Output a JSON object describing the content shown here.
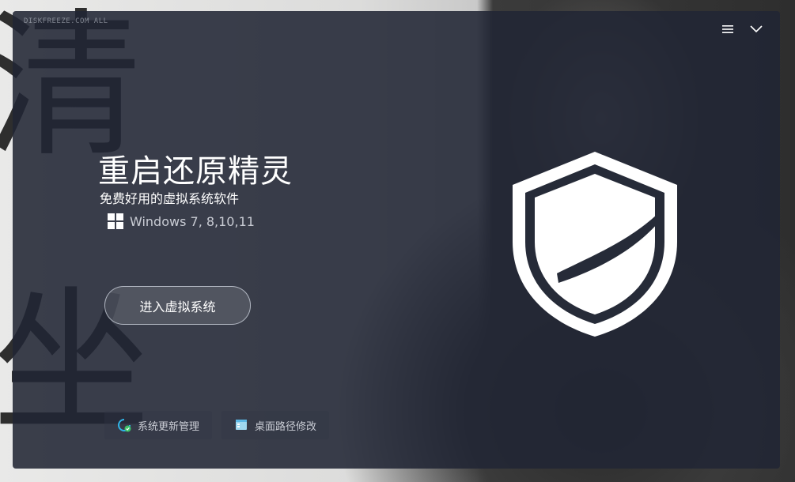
{
  "window": {
    "watermark": "DISKFREEZE.COM ALL"
  },
  "top_controls": {
    "menu_icon": "hamburger-menu-icon",
    "collapse_icon": "chevron-down-icon"
  },
  "hero": {
    "title": "重启还原精灵",
    "subtitle": "免费好用的虚拟系统软件",
    "os_label": "Windows  7, 8,10,11",
    "os_icon": "windows-logo-icon"
  },
  "actions": {
    "enter_label": "进入虚拟系统"
  },
  "tools": [
    {
      "label": "系统更新管理",
      "icon": "refresh-check-icon"
    },
    {
      "label": "桌面路径修改",
      "icon": "desktop-folder-icon"
    }
  ],
  "background": {
    "glyph_top": "清",
    "glyph_bottom": "坐"
  },
  "colors": {
    "window_bg": "#212634",
    "accent_cyan": "#2fb5e8",
    "accent_green": "#3cc26a",
    "text_primary": "#ffffff",
    "text_secondary": "#c9ccd4"
  }
}
